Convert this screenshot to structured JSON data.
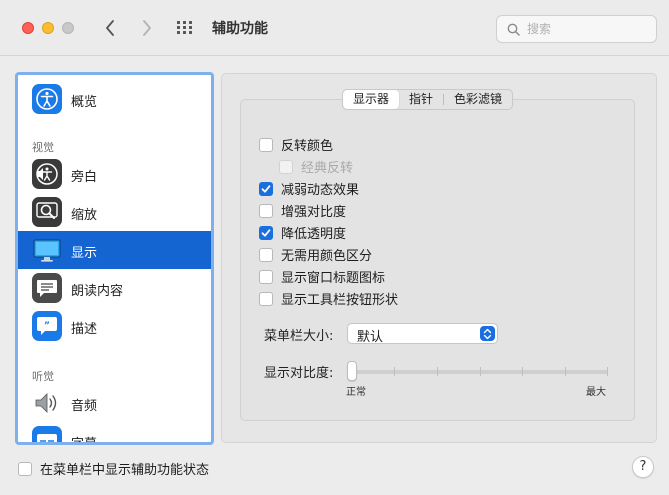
{
  "window": {
    "title": "辅助功能"
  },
  "search": {
    "placeholder": "搜索"
  },
  "sidebar": {
    "top_item": {
      "label": "概览",
      "icon": "accessibility-icon"
    },
    "sections": [
      {
        "title": "视觉"
      },
      {
        "title": "听觉"
      }
    ],
    "vision_items": [
      {
        "label": "旁白",
        "icon": "voiceover-icon"
      },
      {
        "label": "缩放",
        "icon": "zoom-icon"
      },
      {
        "label": "显示",
        "icon": "display-icon",
        "selected": true
      },
      {
        "label": "朗读内容",
        "icon": "spoken-content-icon"
      },
      {
        "label": "描述",
        "icon": "descriptions-icon"
      }
    ],
    "hearing_items": [
      {
        "label": "音频",
        "icon": "audio-icon"
      },
      {
        "label": "字幕",
        "icon": "captions-icon"
      }
    ]
  },
  "tabs": [
    {
      "label": "显示器",
      "selected": true
    },
    {
      "label": "指针"
    },
    {
      "label": "色彩滤镜"
    }
  ],
  "options": [
    {
      "label": "反转颜色",
      "checked": false
    },
    {
      "label": "经典反转",
      "checked": false,
      "disabled": true
    },
    {
      "label": "减弱动态效果",
      "checked": true
    },
    {
      "label": "增强对比度",
      "checked": false
    },
    {
      "label": "降低透明度",
      "checked": true
    },
    {
      "label": "无需用颜色区分",
      "checked": false
    },
    {
      "label": "显示窗口标题图标",
      "checked": false
    },
    {
      "label": "显示工具栏按钮形状",
      "checked": false
    }
  ],
  "menubar_size": {
    "label": "菜单栏大小:",
    "value": "默认"
  },
  "contrast": {
    "label": "显示对比度:",
    "min_label": "正常",
    "max_label": "最大",
    "value": 0
  },
  "footer": {
    "show_status_label": "在菜单栏中显示辅助功能状态",
    "checked": false,
    "help": "?"
  },
  "colors": {
    "accent": "#1a6fe0",
    "selection": "#1464d2",
    "sidebar_focus": "#7fb0ee"
  }
}
